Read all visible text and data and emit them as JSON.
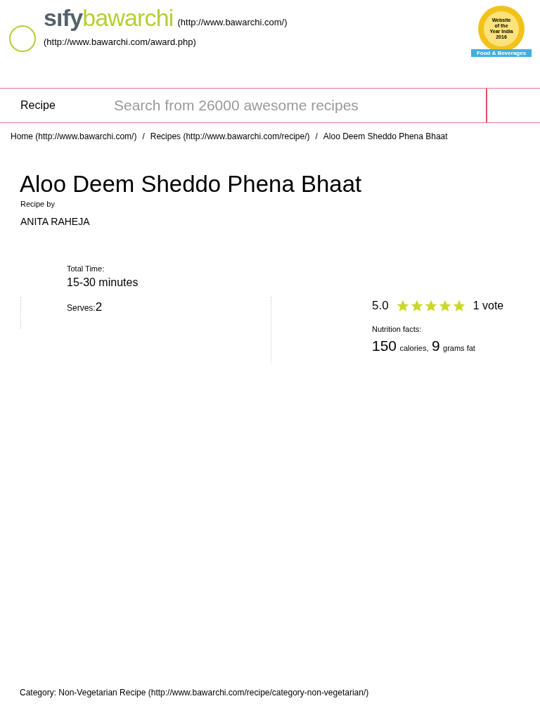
{
  "header": {
    "logo_left": "sıfy",
    "logo_right": "bawarchi",
    "home_link": "(http://www.bawarchi.com/)",
    "award_link": "(http://www.bawarchi.com/award.php)",
    "badge": {
      "lines": [
        "Website",
        "of the",
        "Year India",
        "2016"
      ],
      "ribbon": "Food & Beverages"
    }
  },
  "search_bar": {
    "label": "Recipe",
    "placeholder": "Search from 26000 awesome recipes"
  },
  "breadcrumb_separator": "/",
  "breadcrumb": [
    "Home (http://www.bawarchi.com/)",
    "Recipes (http://www.bawarchi.com/recipe/)",
    "Aloo Deem Sheddo Phena Bhaat"
  ],
  "recipe": {
    "title": "Aloo Deem Sheddo Phena Bhaat",
    "byline_label": "Recipe by",
    "author": "ANITA RAHEJA",
    "total_time_label": "Total Time:",
    "total_time": "15-30 minutes",
    "serves_label": "Serves:",
    "serves": "2"
  },
  "rating": {
    "score": "5.0",
    "stars": 5,
    "votes": "1 vote"
  },
  "nutrition": {
    "label": "Nutrition facts:",
    "calories": "150",
    "calories_unit": "calories,",
    "fat": "9",
    "fat_unit": "grams fat"
  },
  "category": "Category: Non-Vegetarian Recipe (http://www.bawarchi.com/recipe/category-non-vegetarian/)"
}
